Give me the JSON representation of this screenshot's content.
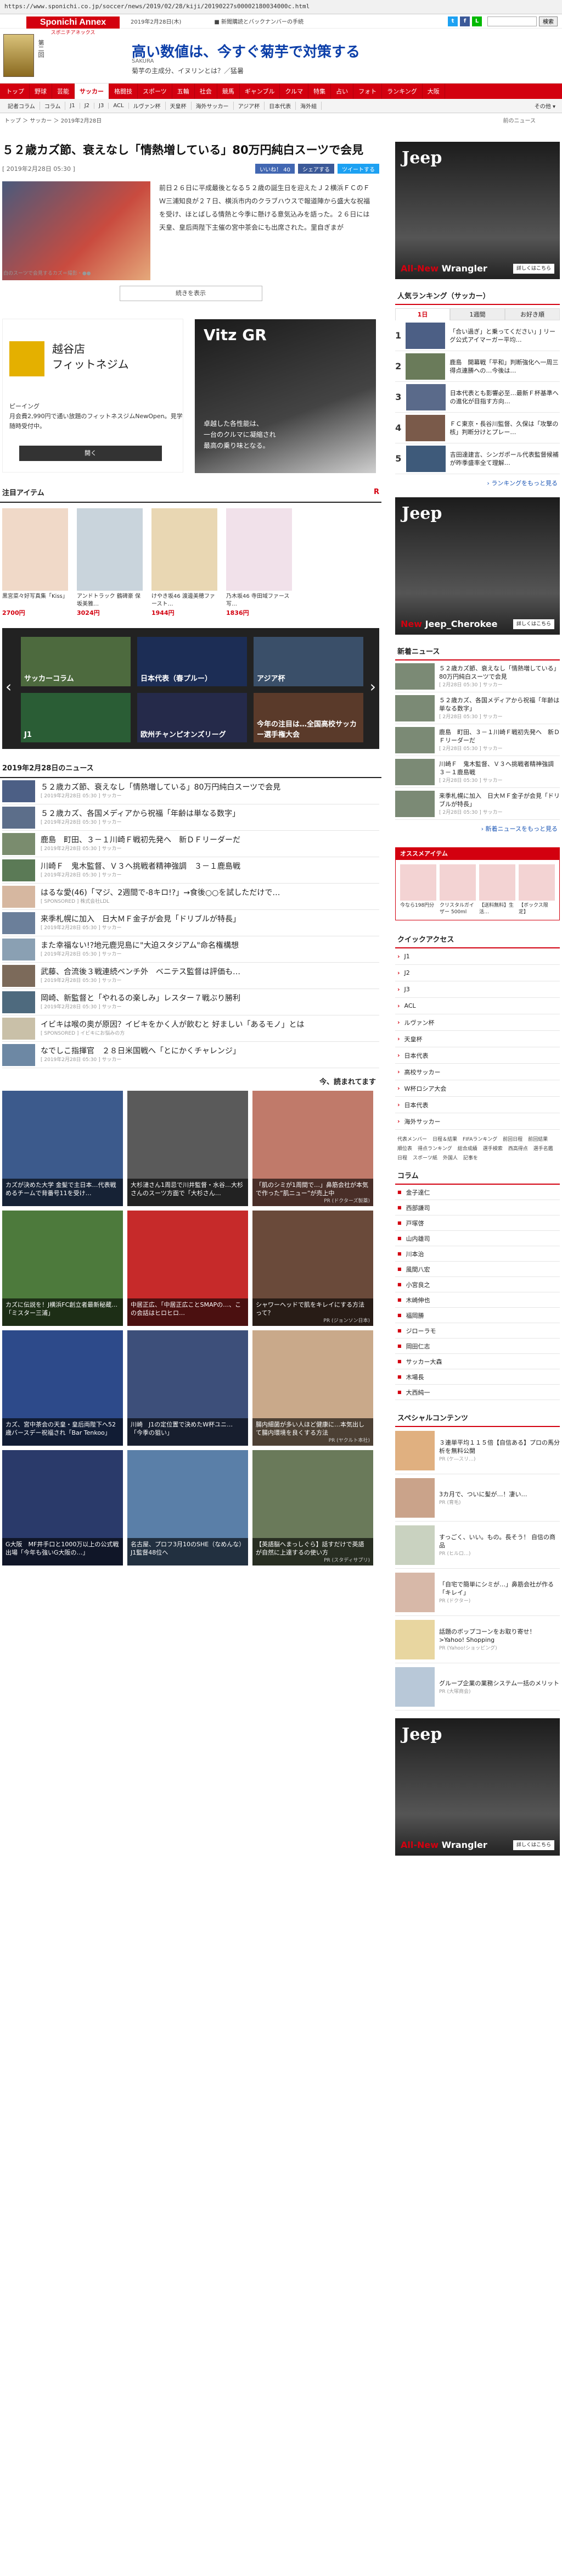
{
  "browser": {
    "url": "https://www.sponichi.co.jp/soccer/news/2019/02/28/kiji/20190227s00002180034000c.html"
  },
  "header": {
    "logo_main": "Sponichi Annex",
    "logo_sub": "スポニチアネックス",
    "date": "2019年2月28日(木)",
    "newsflash": "■ 新聞購読とバックナンバーの手続",
    "search_button": "検索",
    "ad_book_label": "第二回",
    "ad_title": "高い数値は、今すぐ菊芋で対策する",
    "ad_sponsor": "SAKURA",
    "ad_sub": "菊芋の主成分、イヌリンとは？／猛暑"
  },
  "nav": {
    "items": [
      "トップ",
      "野球",
      "芸能",
      "サッカー",
      "格闘技",
      "スポーツ",
      "五輪",
      "社会",
      "競馬",
      "ギャンブル",
      "クルマ",
      "特集",
      "占い",
      "フォト",
      "ランキング",
      "大阪"
    ],
    "active_index": 3
  },
  "subnav": {
    "items": [
      "記者コラム",
      "コラム",
      "J1",
      "J2",
      "J3",
      "ACL",
      "ルヴァン杯",
      "天皇杯",
      "海外サッカー",
      "アジア杯",
      "日本代表",
      "海外組"
    ],
    "more": "その他 ▾"
  },
  "breadcrumb": {
    "path": "トップ ＞ サッカー ＞ 2019年2月28日",
    "right_link": "前のニュース"
  },
  "article": {
    "title": "５２歳カズ節、衰えなし「情熱増している」80万円純白スーツで会見",
    "date": "[ 2019年2月28日 05:30 ]",
    "share_like": "いいね！ 40",
    "share_fb": "シェアする",
    "share_tw": "ツイートする",
    "photo_caption": "白のスーツで会見するカズ＝撮影・●●",
    "text": "前日２６日に平成最後となる５２歳の誕生日を迎えたＪ２横浜ＦＣのＦＷ三浦知良が２７日、横浜市内のクラブハウスで報道陣から盛大な祝福を受け、ほとばしる情熱と今季に懸ける意気込みを語った。２６日には天皇、皇后両陛下主催の宮中茶会にも出席された。里自ぎまが",
    "read_more": "続きを表示"
  },
  "ads": {
    "left_title": "越谷店\nフィットネジム",
    "left_brand": "ピーイング",
    "left_text": "月会費2,990円で通い放題のフィットネスジムNewOpen。見学随時受付中。",
    "left_button": "開く",
    "right_title": "Vitz GR",
    "right_copy": "卓越した各性能は、\n一台のクルマに凝縮され\n最高の乗り味となる。"
  },
  "items_section": {
    "title": "注目アイテム",
    "badge": "R",
    "items": [
      {
        "name": "黒宮菜々好写真集「Kiss」",
        "price": "2700円"
      },
      {
        "name": "アンドトラック 鶴碑豪 保坂美雅…",
        "price": "3024円"
      },
      {
        "name": "けやき坂46 渡邊美穂ファースト…",
        "price": "1944円"
      },
      {
        "name": "乃木坂46 寺田域ファース写…",
        "price": "1836円"
      }
    ]
  },
  "carousel": {
    "cards": [
      "サッカーコラム",
      "日本代表（春プルー）",
      "アジア杯",
      "J1",
      "欧州チャンピオンズリーグ",
      "今年の注目は…全国高校サッカー選手権大会"
    ]
  },
  "news_section": {
    "title": "2019年2月28日のニュース",
    "rows": [
      {
        "title": "５２歳カズ節、衰えなし「情熱増している」80万円純白スーツで会見",
        "date": "[ 2019年2月28日 05:30 ] サッカー"
      },
      {
        "title": "５２歳カズ、各国メディアから祝福「年齢は単なる数字」",
        "date": "[ 2019年2月28日 05:30 ] サッカー"
      },
      {
        "title": "鹿島　町田、３－１川崎Ｆ戦初先発へ　新ＤＦリーダーだ",
        "date": "[ 2019年2月28日 05:30 ] サッカー"
      },
      {
        "title": "川崎Ｆ　鬼木監督、Ｖ３へ挑戦者精神強調　３－１鹿島戦",
        "date": "[ 2019年2月28日 05:30 ] サッカー"
      },
      {
        "title": "はるな愛(46)「マジ、2週間で-8キロ!?」→食後○○を試しただけで…",
        "date": "[ SPONSORED ] 株式会社LDL"
      },
      {
        "title": "来季札幌に加入　日大ＭＦ金子が会見「ドリブルが特長」",
        "date": "[ 2019年2月28日 05:30 ] サッカー"
      },
      {
        "title": "また幸福ない!?地元鹿児島に\"大迫スタジアム\"命名権構想",
        "date": "[ 2019年2月28日 05:30 ] サッカー"
      },
      {
        "title": "武藤、合流後３戦連続ベンチ外　ベニテス監督は評価も…",
        "date": "[ 2019年2月28日 05:30 ] サッカー"
      },
      {
        "title": "岡崎、新監督と「やれるの楽しみ」レスター７戦ぶり勝利",
        "date": "[ 2019年2月28日 05:30 ] サッカー"
      },
      {
        "title": "イビキは喉の奥が原因？イビキをかく人が飲むと 好ましい「あるモノ」とは",
        "date": "[ SPONSORED ] イビキにお悩みの方"
      },
      {
        "title": "なでしこ指揮官　２８日米国戦へ「とにかくチャレンジ」",
        "date": "[ 2019年2月28日 05:30 ] サッカー"
      }
    ]
  },
  "recommend": {
    "title": "今、読まれてます",
    "cards": [
      {
        "caption": "カズが決めた大学 金髪で主日本…代表戦めるチームで背番号11を受け…",
        "pr": ""
      },
      {
        "caption": "大杉漣さん1周忌で川井監督・水谷…大杉さんのスーツ方面で「大杉さん…",
        "pr": ""
      },
      {
        "caption": "「肌のシミが1周間で…」鼻筋会社が本気で作った”肌ニュー”が売上中",
        "pr": "PR (ドクターズ製薬)"
      },
      {
        "caption": "カズに伝説を！J横浜FC創立者最新秘蔵…「ミスター三浦」",
        "pr": ""
      },
      {
        "caption": "中居正広、「中居正広ことSMAPの…、この会話はヒロヒロ…",
        "pr": ""
      },
      {
        "caption": "シャワーヘッドで肌をキレイにする方法って？",
        "pr": "PR (ジョンソン日本)"
      },
      {
        "caption": "カズ、宮中茶会の天皇・皇后両陛下へ52歳バースデー祝福され「Bar Tenkoo」",
        "pr": ""
      },
      {
        "caption": "川崎　J1の定位置で決めたW杯ユニ…「今季の狙い」",
        "pr": ""
      },
      {
        "caption": "腸内細菌が多い人ほど健康に…本気出して腸内環境を良くする方法",
        "pr": "PR (ヤクルト本社)"
      },
      {
        "caption": "G大阪　MF井手口と1000万以上の公式戦出場「今年も強いG大阪の…」",
        "pr": ""
      },
      {
        "caption": "名古屋、プロフ3月10のSHE（なめんな）J1監督48位へ",
        "pr": ""
      },
      {
        "caption": "【英語脳へまっしぐら】話すだけで英語が自然に上達するの使い方",
        "pr": "PR (スタディサプリ)"
      }
    ]
  },
  "side": {
    "jeep_brand": "Jeep",
    "jeep_model_a": "All-New",
    "jeep_model_b": " Wrangler",
    "jeep_detail": "詳しくはこちら",
    "ranking_head": "人気ランキング（サッカー）",
    "ranking_tabs": [
      "1日",
      "1週間",
      "お好き順"
    ],
    "ranking_rows": [
      "「合い過ぎ」と乗ってください」J リーグ公式アイマーガー平均…",
      "鹿島　開幕戦「平和」判断強化へ一周三得点連勝への…今後は…",
      "日本代表とも影響必至…最新Ｆ杯基準への進化が目指す方向…",
      "ＦＣ東京・長谷川監督、久保は「攻撃の核」判断分けとプレー…",
      "吉田達建言、シンガポール代表監督候補が昨季盛率全て理解…"
    ],
    "ranking_more": "› ランキングをもっと見る",
    "jeep2_model_a": "New",
    "jeep2_model_b": " Jeep_Cherokee",
    "news_head": "新着ニュース",
    "news_rows": [
      {
        "title": "５２歳カズ節、衰えなし「情熱増している」80万円純白スーツで会見",
        "date": "[ 2月28日 05:30 ] サッカー"
      },
      {
        "title": "５２歳カズ、各国メディアから祝福「年齢は単なる数字」",
        "date": "[ 2月28日 05:30 ] サッカー"
      },
      {
        "title": "鹿島　町田、３－１川崎Ｆ戦初先発へ　新ＤＦリーダーだ",
        "date": "[ 2月28日 05:30 ] サッカー"
      },
      {
        "title": "川崎Ｆ　鬼木監督、Ｖ３へ挑戦者精神強調　３－１鹿島戦",
        "date": "[ 2月28日 05:30 ] サッカー"
      },
      {
        "title": "来季札幌に加入　日大ＭＦ金子が会見「ドリブルが特長」",
        "date": "[ 2月28日 05:30 ] サッカー"
      }
    ],
    "news_more": "› 新着ニュースをもっと見る",
    "osusume_head": "オススメアイテム",
    "osusume_items": [
      "今なら198円分",
      "クリスタルガイザー 500ml",
      "【送料無料】生活…",
      "【ボックス限定】"
    ],
    "quick_head": "クイックアクセス",
    "quick_items": [
      "J1",
      "J2",
      "J3",
      "ACL",
      "ルヴァン杯",
      "天皇杯",
      "日本代表",
      "高校サッカー",
      "W杯ロシア大会",
      "日本代表",
      "海外サッカー"
    ],
    "taglinks": [
      "代表メンバー",
      "日程＆結果",
      "FIFAランキング",
      "前回日程",
      "前回結果",
      "順位表",
      "得点ランキング",
      "総合成績",
      "選手検索",
      "西高得点",
      "選手名鑑",
      "日程",
      "スポーツ紙",
      "外国人",
      "記事を"
    ],
    "column_head": "コラム",
    "column_items": [
      "金子達仁",
      "西部謙司",
      "戸塚啓",
      "山内雄司",
      "川本治",
      "風間八宏",
      "小宮良之",
      "木崎伸也",
      "福岡勝",
      "ジローラモ",
      "岡田仁志",
      "サッカー大森",
      "木場長",
      "大西純一"
    ],
    "special_head": "スペシャルコンテンツ",
    "special_rows": [
      {
        "title": "３連単平均１１５倍【自信ある】プロの馬分析を無料公開",
        "src": "PR (ケ―スリ…)"
      },
      {
        "title": "3カ月で、ついに髪が…！凄い…",
        "src": "PR (育毛)"
      },
      {
        "title": "すっごく、いい。もの。長そう！ 自信の商品",
        "src": "PR (ヒルロ…)"
      },
      {
        "title": "「自宅で簡単にシミが…」鼻筋会社が作る「キレイ」",
        "src": "PR (ドクター)"
      },
      {
        "title": "話題のボップコーンをお取り寄せ！>Yahoo! Shopping",
        "src": "PR (Yahoo!ショッピング)"
      },
      {
        "title": "グループ企業の業務システム一括のメリット",
        "src": "PR (大塚商会)"
      }
    ],
    "jeep3_model_a": "All-New",
    "jeep3_model_b": " Wrangler"
  }
}
